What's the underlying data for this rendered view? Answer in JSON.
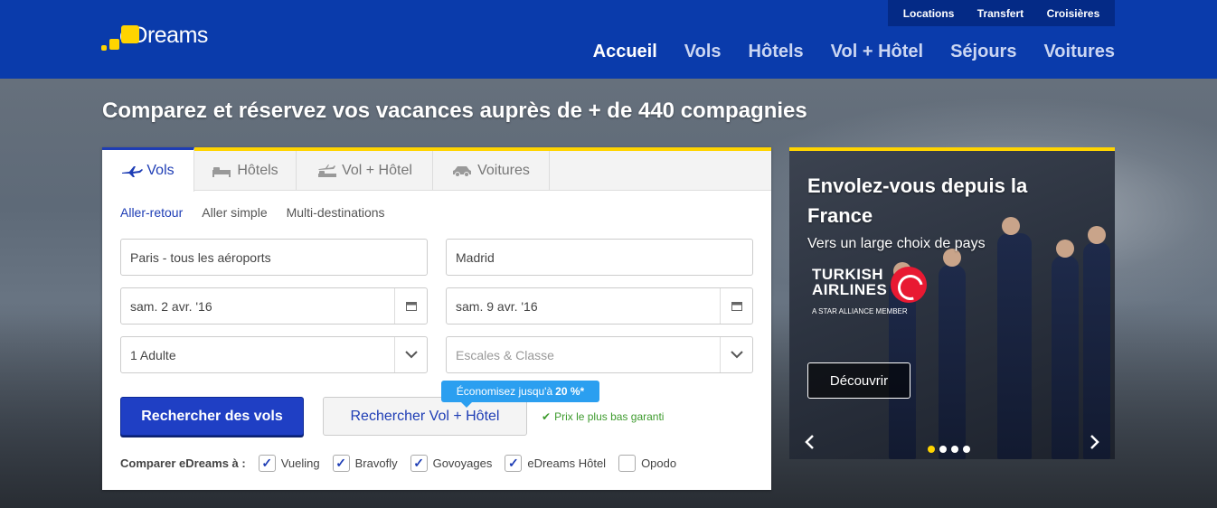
{
  "brand": {
    "name": "eDreams",
    "accent": "#ffd400",
    "primary": "#0a3bab"
  },
  "topnav": [
    {
      "label": "Locations"
    },
    {
      "label": "Transfert"
    },
    {
      "label": "Croisières"
    }
  ],
  "mainnav": [
    {
      "label": "Accueil",
      "active": true
    },
    {
      "label": "Vols"
    },
    {
      "label": "Hôtels"
    },
    {
      "label": "Vol + Hôtel"
    },
    {
      "label": "Séjours"
    },
    {
      "label": "Voitures"
    }
  ],
  "hero": {
    "title": "Comparez et réservez vos vacances auprès de + de 440 compagnies"
  },
  "search": {
    "tabs": [
      {
        "label": "Vols",
        "icon": "plane-icon",
        "active": true
      },
      {
        "label": "Hôtels",
        "icon": "bed-icon"
      },
      {
        "label": "Vol + Hôtel",
        "icon": "plane-bed-icon"
      },
      {
        "label": "Voitures",
        "icon": "car-icon"
      }
    ],
    "trip_types": [
      {
        "label": "Aller-retour",
        "selected": true
      },
      {
        "label": "Aller simple"
      },
      {
        "label": "Multi-destinations"
      }
    ],
    "origin": "Paris - tous les aéroports",
    "destination": "Madrid",
    "depart_date": "sam. 2 avr. '16",
    "return_date": "sam. 9 avr. '16",
    "passengers": "1 Adulte",
    "class_placeholder": "Escales & Classe",
    "search_button": "Rechercher des vols",
    "combo_button": "Rechercher Vol + Hôtel",
    "promo_badge_text": "Économisez jusqu'à",
    "promo_badge_value": "20 %*",
    "guarantee": "Prix le plus bas garanti",
    "compare_label": "Comparer eDreams à :",
    "compare_sites": [
      {
        "label": "Vueling",
        "checked": true
      },
      {
        "label": "Bravofly",
        "checked": true
      },
      {
        "label": "Govoyages",
        "checked": true
      },
      {
        "label": "eDreams Hôtel",
        "checked": true
      },
      {
        "label": "Opodo",
        "checked": false
      }
    ]
  },
  "promo": {
    "heading": "Envolez-vous depuis la France",
    "subheading": "Vers un large choix de pays",
    "airline_line1": "TURKISH",
    "airline_line2": "AIRLINES",
    "alliance": "A STAR ALLIANCE MEMBER",
    "cta": "Découvrir",
    "slide_count": 4,
    "active_slide": 1
  }
}
